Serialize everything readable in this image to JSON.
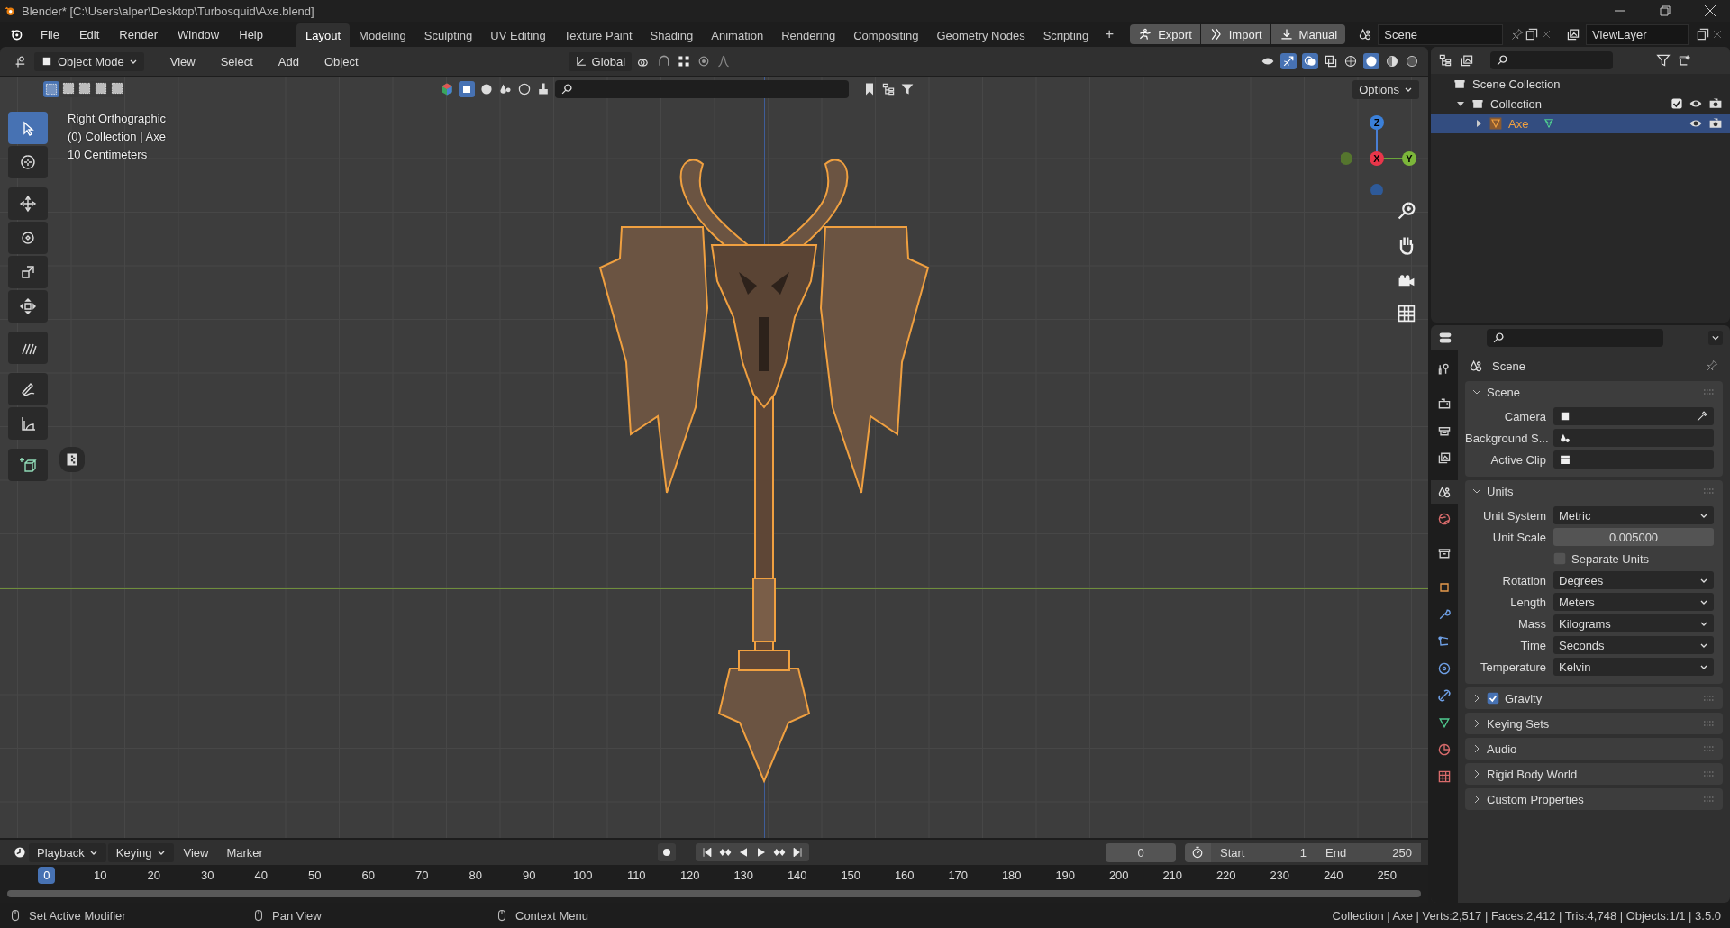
{
  "window": {
    "title": "Blender* [C:\\Users\\alper\\Desktop\\Turbosquid\\Axe.blend]"
  },
  "menu": [
    "File",
    "Edit",
    "Render",
    "Window",
    "Help"
  ],
  "workspaces": [
    {
      "label": "Layout",
      "selected": true
    },
    {
      "label": "Modeling",
      "selected": false
    },
    {
      "label": "Sculpting",
      "selected": false
    },
    {
      "label": "UV Editing",
      "selected": false
    },
    {
      "label": "Texture Paint",
      "selected": false
    },
    {
      "label": "Shading",
      "selected": false
    },
    {
      "label": "Animation",
      "selected": false
    },
    {
      "label": "Rendering",
      "selected": false
    },
    {
      "label": "Compositing",
      "selected": false
    },
    {
      "label": "Geometry Nodes",
      "selected": false
    },
    {
      "label": "Scripting",
      "selected": false
    }
  ],
  "add_workspace": "+",
  "addon_buttons": [
    {
      "kind": "export",
      "label": "Export"
    },
    {
      "kind": "import",
      "label": "Import"
    },
    {
      "kind": "manual",
      "label": "Manual"
    }
  ],
  "scene_field": "Scene",
  "view_layer_field": "ViewLayer",
  "viewport_header": {
    "mode": "Object Mode",
    "menus": [
      "View",
      "Select",
      "Add",
      "Object"
    ],
    "orientation": "Global",
    "options": "Options"
  },
  "viewport_info": [
    "Right Orthographic",
    "(0) Collection | Axe",
    "10 Centimeters"
  ],
  "gizmo": {
    "z": "Z",
    "x": "X",
    "y": "Y"
  },
  "tools": [
    {
      "kind": "select",
      "selected": true
    },
    {
      "kind": "cursor",
      "selected": false
    },
    {
      "kind": "move",
      "selected": false
    },
    {
      "kind": "rotate",
      "selected": false
    },
    {
      "kind": "scale",
      "selected": false
    },
    {
      "kind": "transform",
      "selected": false
    },
    {
      "kind": "annotate",
      "selected": false
    },
    {
      "kind": "draw",
      "selected": false
    },
    {
      "kind": "measure",
      "selected": false
    },
    {
      "kind": "add_cube",
      "selected": false
    }
  ],
  "outliner": [
    {
      "label": "Scene Collection",
      "kind": "scene",
      "children": [
        {
          "label": "Collection",
          "kind": "collection",
          "checked": true,
          "expanded": true,
          "children": [
            {
              "label": "Axe",
              "kind": "object",
              "expanded": false,
              "selected": true
            }
          ]
        }
      ]
    }
  ],
  "properties": {
    "context": "Scene",
    "tabs": [
      {
        "kind": "tool",
        "selected": false
      },
      {
        "kind": "render",
        "selected": false
      },
      {
        "kind": "output",
        "selected": false
      },
      {
        "kind": "view_layer",
        "selected": false
      },
      {
        "kind": "scene",
        "selected": true
      },
      {
        "kind": "world",
        "selected": false
      },
      {
        "kind": "collection",
        "selected": false
      },
      {
        "kind": "object",
        "selected": false
      },
      {
        "kind": "modifier",
        "selected": false
      },
      {
        "kind": "particles",
        "selected": false
      },
      {
        "kind": "physics",
        "selected": false
      },
      {
        "kind": "constraints",
        "selected": false
      },
      {
        "kind": "data",
        "selected": false
      },
      {
        "kind": "material",
        "selected": false
      },
      {
        "kind": "texture",
        "selected": false
      }
    ],
    "panels": [
      {
        "title": "Scene",
        "kind": "panel",
        "expanded": true,
        "rows": [
          {
            "label": "Camera",
            "kind": "camera_picker"
          },
          {
            "label": "Background S...",
            "kind": "scene_picker"
          },
          {
            "label": "Active Clip",
            "kind": "clip_picker"
          }
        ]
      },
      {
        "title": "Units",
        "kind": "panel",
        "expanded": true,
        "rows": [
          {
            "label": "Unit System",
            "kind": "dropdown",
            "value": "Metric"
          },
          {
            "label": "Unit Scale",
            "kind": "number",
            "value": "0.005000"
          },
          {
            "label": "Separate Units",
            "kind": "checkbox",
            "checked": false
          },
          {
            "label": "Rotation",
            "kind": "dropdown",
            "value": "Degrees"
          },
          {
            "label": "Length",
            "kind": "dropdown",
            "value": "Meters"
          },
          {
            "label": "Mass",
            "kind": "dropdown",
            "value": "Kilograms"
          },
          {
            "label": "Time",
            "kind": "dropdown",
            "value": "Seconds"
          },
          {
            "label": "Temperature",
            "kind": "dropdown",
            "value": "Kelvin"
          }
        ]
      },
      {
        "title": "Gravity",
        "kind": "toggle",
        "checked": true,
        "expanded": false
      },
      {
        "title": "Keying Sets",
        "kind": "panel",
        "expanded": false
      },
      {
        "title": "Audio",
        "kind": "panel",
        "expanded": false
      },
      {
        "title": "Rigid Body World",
        "kind": "panel",
        "expanded": false
      },
      {
        "title": "Custom Properties",
        "kind": "panel",
        "expanded": false
      }
    ]
  },
  "timeline": {
    "menus": [
      "Playback",
      "Keying",
      "View",
      "Marker"
    ],
    "frame": "0",
    "start_label": "Start",
    "start": "1",
    "end_label": "End",
    "end": "250",
    "current": "0",
    "ticks": [
      "10",
      "20",
      "30",
      "40",
      "50",
      "60",
      "70",
      "80",
      "90",
      "100",
      "110",
      "120",
      "130",
      "140",
      "150",
      "160",
      "170",
      "180",
      "190",
      "200",
      "210",
      "220",
      "230",
      "240",
      "250"
    ]
  },
  "status_bar": {
    "hints": [
      "Set Active Modifier",
      "Pan View",
      "Context Menu"
    ],
    "stats": "Collection | Axe | Verts:2,517 | Faces:2,412 | Tris:4,748 | Objects:1/1 | 3.5.0"
  }
}
